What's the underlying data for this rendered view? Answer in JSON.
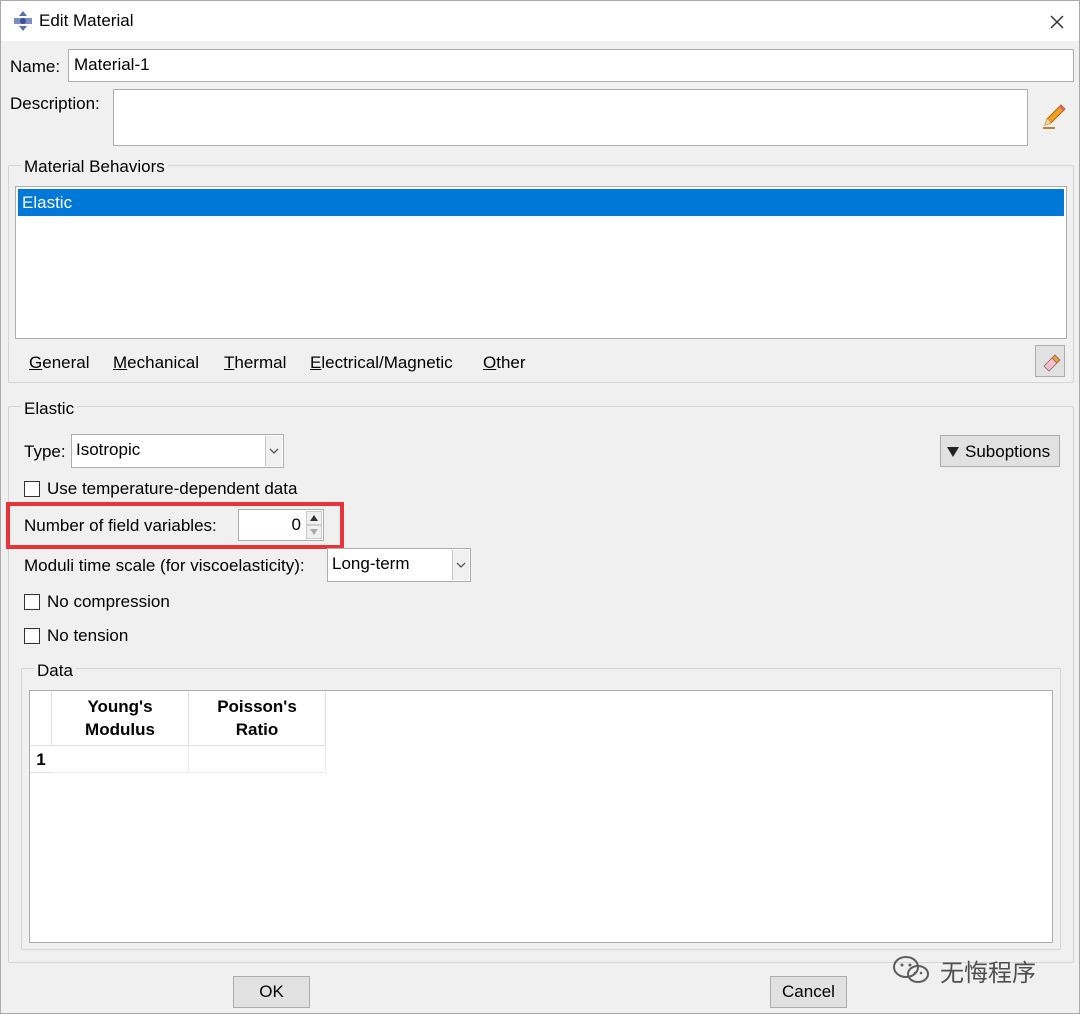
{
  "window": {
    "title": "Edit Material"
  },
  "name": {
    "label": "Name:",
    "value": "Material-1"
  },
  "description": {
    "label": "Description:",
    "value": ""
  },
  "behaviors": {
    "group_label": "Material Behaviors",
    "items": [
      "Elastic"
    ],
    "selected": "Elastic"
  },
  "menu": {
    "general": "General",
    "mechanical": "Mechanical",
    "thermal": "Thermal",
    "electrical": "Electrical/Magnetic",
    "other": "Other"
  },
  "elastic": {
    "group_label": "Elastic",
    "type_label": "Type:",
    "type_value": "Isotropic",
    "suboptions_label": "Suboptions",
    "temp_dependent_label": "Use temperature-dependent data",
    "temp_dependent_checked": false,
    "field_vars_label": "Number of field variables:",
    "field_vars_value": "0",
    "moduli_label": "Moduli time scale (for viscoelasticity):",
    "moduli_value": "Long-term",
    "no_compression_label": "No compression",
    "no_compression_checked": false,
    "no_tension_label": "No tension",
    "no_tension_checked": false
  },
  "data": {
    "group_label": "Data",
    "columns": [
      "Young's\nModulus",
      "Poisson's\nRatio"
    ],
    "col1_line1": "Young's",
    "col1_line2": "Modulus",
    "col2_line1": "Poisson's",
    "col2_line2": "Ratio",
    "rows": [
      {
        "index": "1",
        "values": [
          "",
          ""
        ]
      }
    ]
  },
  "buttons": {
    "ok": "OK",
    "cancel": "Cancel"
  },
  "watermark": "无悔程序",
  "colors": {
    "selection": "#0078d7",
    "highlight_box": "#e8333a"
  },
  "icons": {
    "title": "abaqus-app-icon",
    "edit_description": "pencil-icon",
    "eraser": "eraser-icon"
  }
}
